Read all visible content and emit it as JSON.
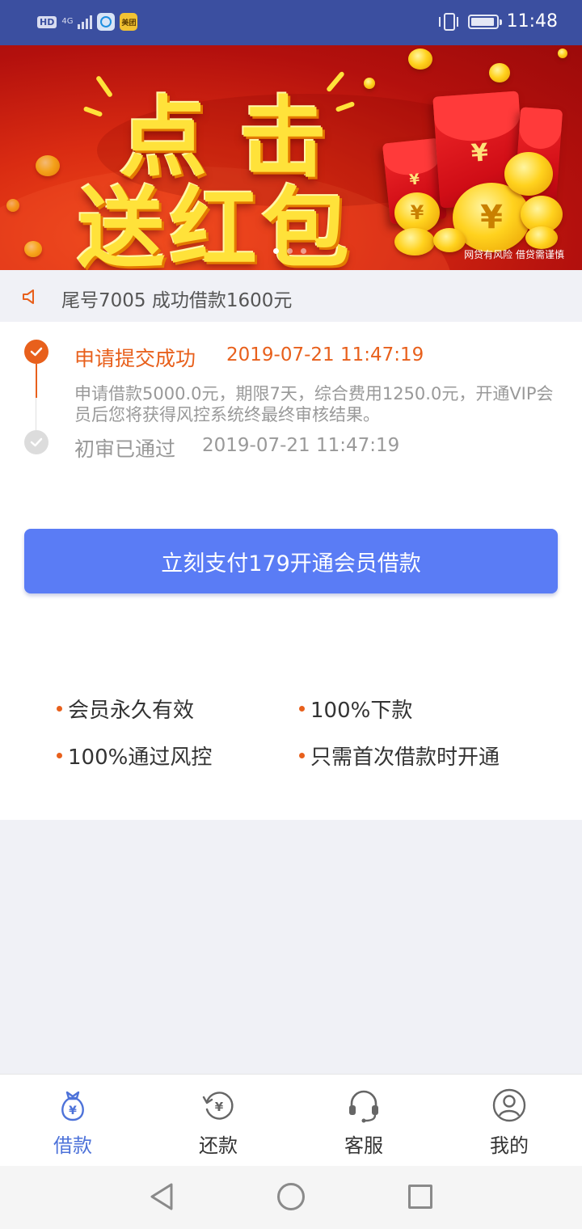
{
  "status_bar": {
    "hd": "HD",
    "network": "4G",
    "app_badge": "美团",
    "time": "11:48"
  },
  "banner": {
    "line1": "点击",
    "line2": "送红包",
    "yen_symbol": "¥",
    "disclaimer": "网贷有风险  借贷需谨慎",
    "dots": 3,
    "active_dot": 0
  },
  "notice": {
    "icon": "speaker-icon",
    "text": "尾号7005 成功借款1600元"
  },
  "steps": [
    {
      "title": "申请提交成功",
      "time": "2019-07-21 11:47:19",
      "description": "申请借款5000.0元，期限7天，综合费用1250.0元，开通VIP会员后您将获得风控系统终最终审核结果。",
      "state": "done"
    },
    {
      "title": "初审已通过",
      "time": "2019-07-21 11:47:19",
      "state": "pending"
    }
  ],
  "pay_button": "立刻支付179开通会员借款",
  "features": [
    "会员永久有效",
    "100%下款",
    "100%通过风控",
    "只需首次借款时开通"
  ],
  "tabs": [
    {
      "label": "借款",
      "icon": "money-bag-icon",
      "active": true
    },
    {
      "label": "还款",
      "icon": "repay-icon",
      "active": false
    },
    {
      "label": "客服",
      "icon": "headset-icon",
      "active": false
    },
    {
      "label": "我的",
      "icon": "user-icon",
      "active": false
    }
  ],
  "colors": {
    "status_bar": "#3b4fa0",
    "accent_orange": "#e8601c",
    "button_blue": "#5a7cf5",
    "tab_active": "#4d72d9"
  }
}
